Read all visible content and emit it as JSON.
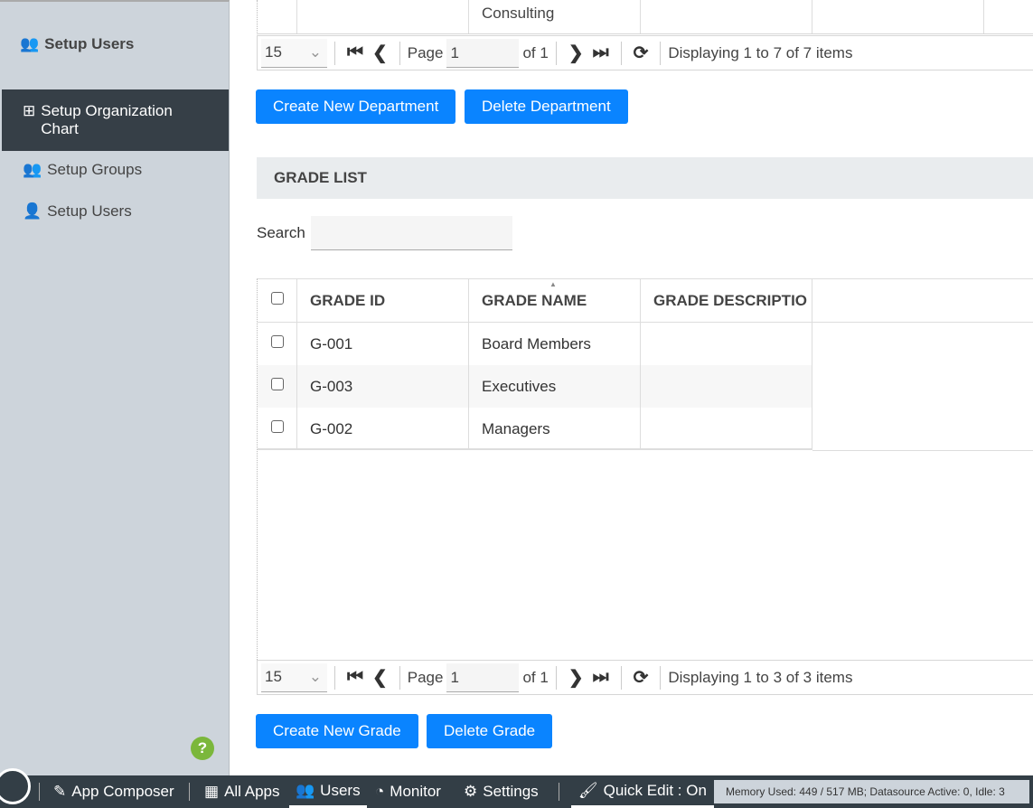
{
  "sidebar": {
    "header": "Setup Users",
    "items": [
      {
        "label": "Setup Organization Chart",
        "active": true
      },
      {
        "label": "Setup Groups"
      },
      {
        "label": "Setup Users"
      }
    ],
    "help": "?"
  },
  "dept_table": {
    "partial_cell": "Consulting",
    "pager": {
      "page_size": "15",
      "page_label": "Page",
      "page": "1",
      "of": "of 1",
      "display": "Displaying 1 to 7 of 7 items"
    },
    "create_button": "Create New Department",
    "delete_button": "Delete Department"
  },
  "grade": {
    "title": "GRADE LIST",
    "search_label": "Search",
    "search_value": "",
    "columns": [
      "GRADE ID",
      "GRADE NAME",
      "GRADE DESCRIPTIO"
    ],
    "rows": [
      {
        "id": "G-001",
        "name": "Board Members",
        "desc": ""
      },
      {
        "id": "G-003",
        "name": "Executives",
        "desc": ""
      },
      {
        "id": "G-002",
        "name": "Managers",
        "desc": ""
      }
    ],
    "pager": {
      "page_size": "15",
      "page_label": "Page",
      "page": "1",
      "of": "of 1",
      "display": "Displaying 1 to 3 of 3 items"
    },
    "create_button": "Create New Grade",
    "delete_button": "Delete Grade"
  },
  "bottombar": {
    "items": [
      "App Composer",
      "All Apps",
      "Users",
      "Monitor",
      "Settings"
    ],
    "quick_edit": "Quick Edit : On",
    "memory": "Memory Used: 449 / 517 MB; Datasource Active: 0, Idle: 3"
  }
}
